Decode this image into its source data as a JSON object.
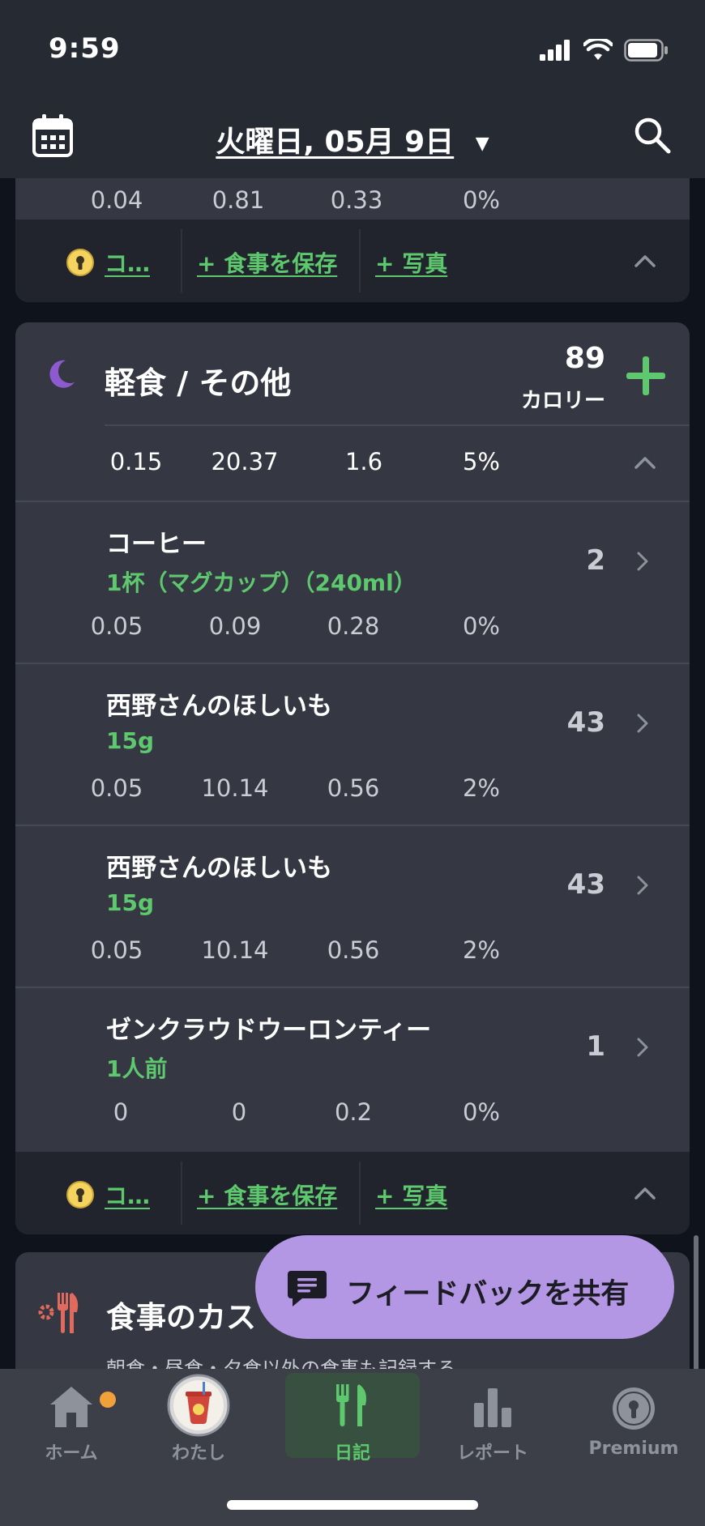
{
  "status": {
    "time": "9:59"
  },
  "header": {
    "date": "火曜日, 05月 9日"
  },
  "prev_card": {
    "nums": [
      "0.04",
      "0.81",
      "0.33",
      "0%"
    ],
    "coin_label": "コ…",
    "save_meal": "+ 食事を保存",
    "photo": "+ 写真"
  },
  "snack": {
    "name": "軽食 / その他",
    "calories": "89",
    "calories_label": "カロリー",
    "totals": [
      "0.15",
      "20.37",
      "1.6",
      "5%"
    ],
    "items": [
      {
        "name": "コーヒー",
        "serving": "1杯（マグカップ）（240ml）",
        "calories": "2",
        "nums": [
          "0.05",
          "0.09",
          "0.28",
          "0%"
        ]
      },
      {
        "name": "西野さんのほしいも",
        "serving": "15g",
        "calories": "43",
        "nums": [
          "0.05",
          "10.14",
          "0.56",
          "2%"
        ]
      },
      {
        "name": "西野さんのほしいも",
        "serving": "15g",
        "calories": "43",
        "nums": [
          "0.05",
          "10.14",
          "0.56",
          "2%"
        ]
      },
      {
        "name": "ゼンクラウドウーロンティー",
        "serving": "1人前",
        "calories": "1",
        "nums": [
          "0",
          "0",
          "0.2",
          "0%"
        ]
      }
    ],
    "coin_label": "コ…",
    "save_meal": "+ 食事を保存",
    "photo": "+ 写真"
  },
  "custom": {
    "title": "食事のカス",
    "subtitle": "朝食・昼食・夕食以外の食事も記録する"
  },
  "feedback": {
    "label": "フィードバックを共有"
  },
  "tabs": [
    {
      "label": "ホーム",
      "icon": "home-icon"
    },
    {
      "label": "わたし",
      "icon": "avatar"
    },
    {
      "label": "日記",
      "icon": "fork-knife-icon"
    },
    {
      "label": "レポート",
      "icon": "bar-chart-icon"
    },
    {
      "label": "Premium",
      "icon": "premium-keyhole-icon"
    }
  ],
  "colors": {
    "accent_green": "#5dc86e",
    "feedback_purple": "#b497e4",
    "moon_purple": "#8e5ad0",
    "coin_yellow": "#f4d35e",
    "notification_orange": "#f0a13a"
  }
}
